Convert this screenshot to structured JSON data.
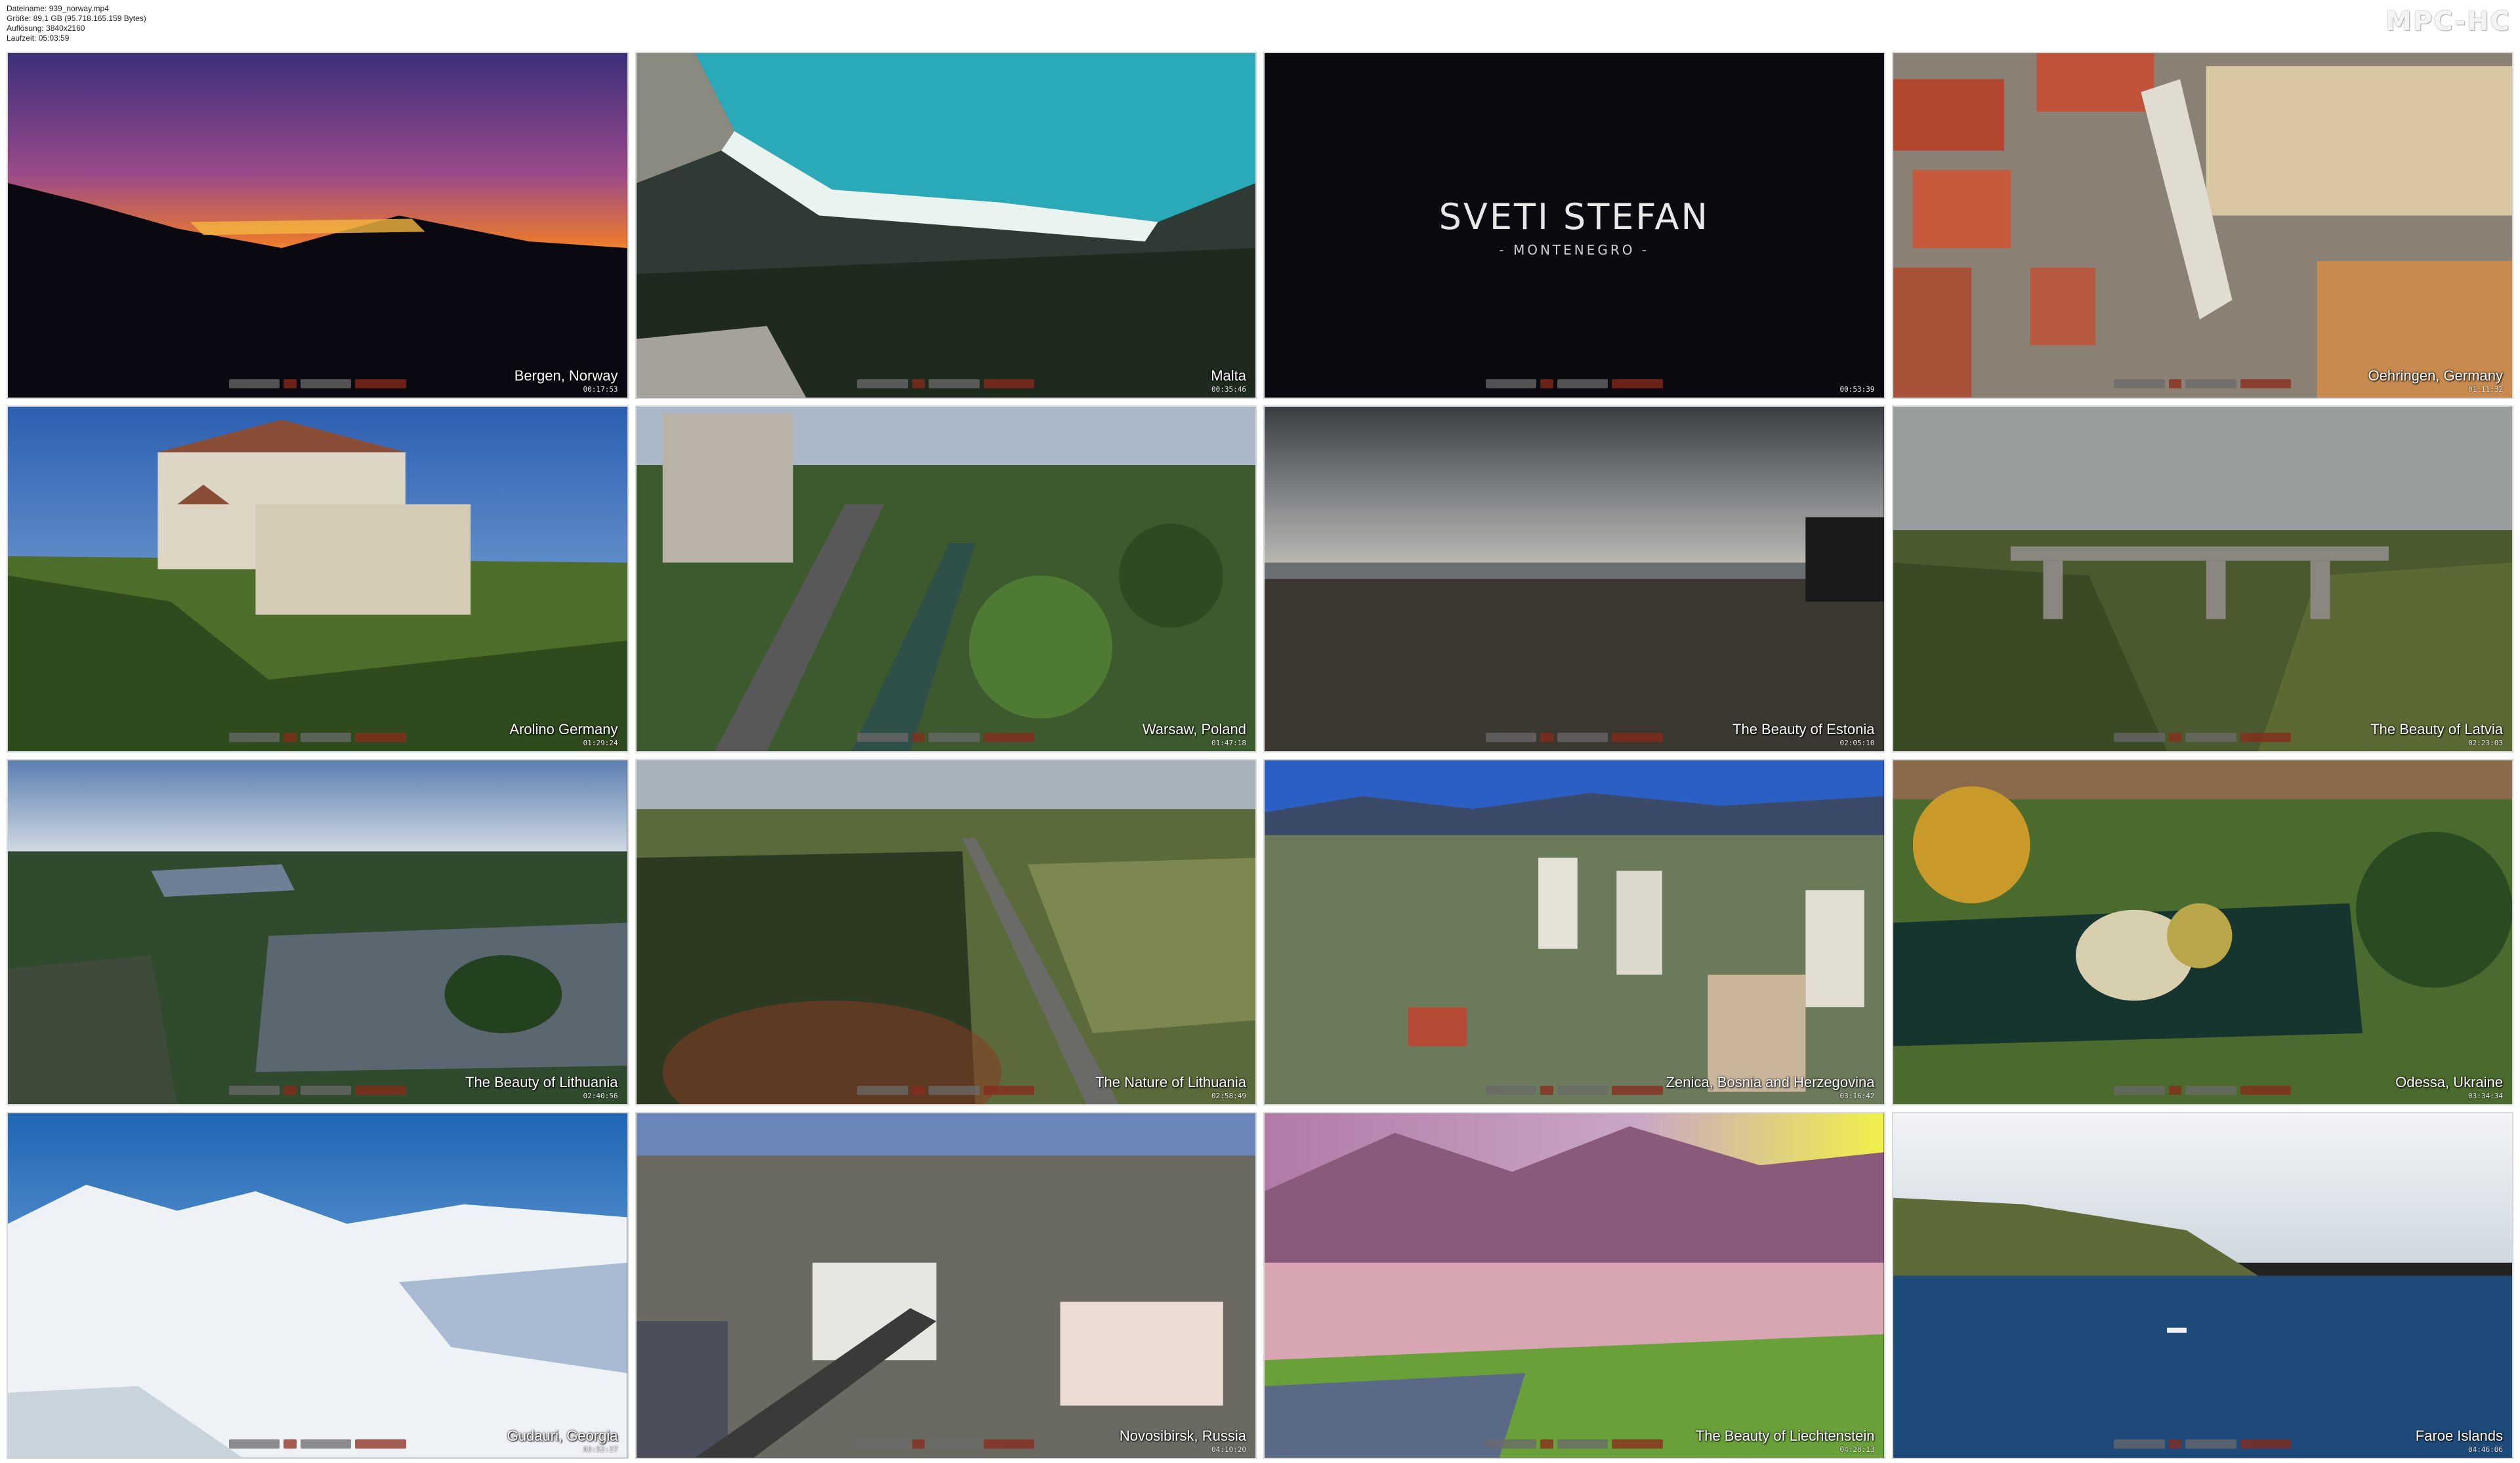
{
  "file_info": {
    "lines": [
      "Dateiname: 939_norway.mp4",
      "Größe: 89,1 GB (95.718.165.159 Bytes)",
      "Auflösung: 3840x2160",
      "Laufzeit: 05:03:59"
    ]
  },
  "logo": "MPC-HC",
  "thumbnails": [
    {
      "title": "Bergen, Norway",
      "time": "00:17:53"
    },
    {
      "title": "Malta",
      "time": "00:35:46"
    },
    {
      "title": "",
      "time": "00:53:39",
      "overlay_title": "SVETI STEFAN",
      "overlay_subtitle": "- MONTENEGRO -"
    },
    {
      "title": "Oehringen, Germany",
      "time": "01:11:32"
    },
    {
      "title": "Arolino Germany",
      "time": "01:29:24"
    },
    {
      "title": "Warsaw, Poland",
      "time": "01:47:18"
    },
    {
      "title": "The Beauty of Estonia",
      "time": "02:05:10"
    },
    {
      "title": "The Beauty of Latvia",
      "time": "02:23:03"
    },
    {
      "title": "The Beauty of Lithuania",
      "time": "02:40:56"
    },
    {
      "title": "The Nature of Lithuania",
      "time": "02:58:49"
    },
    {
      "title": "Zenica, Bosnia and Herzegovina",
      "time": "03:16:42"
    },
    {
      "title": "Odessa, Ukraine",
      "time": "03:34:34"
    },
    {
      "title": "Gudauri, Georgia",
      "time": "03:52:27"
    },
    {
      "title": "Novosibirsk, Russia",
      "time": "04:10:20"
    },
    {
      "title": "The Beauty of Liechtenstein",
      "time": "04:28:13"
    },
    {
      "title": "Faroe Islands",
      "time": "04:46:06"
    }
  ]
}
